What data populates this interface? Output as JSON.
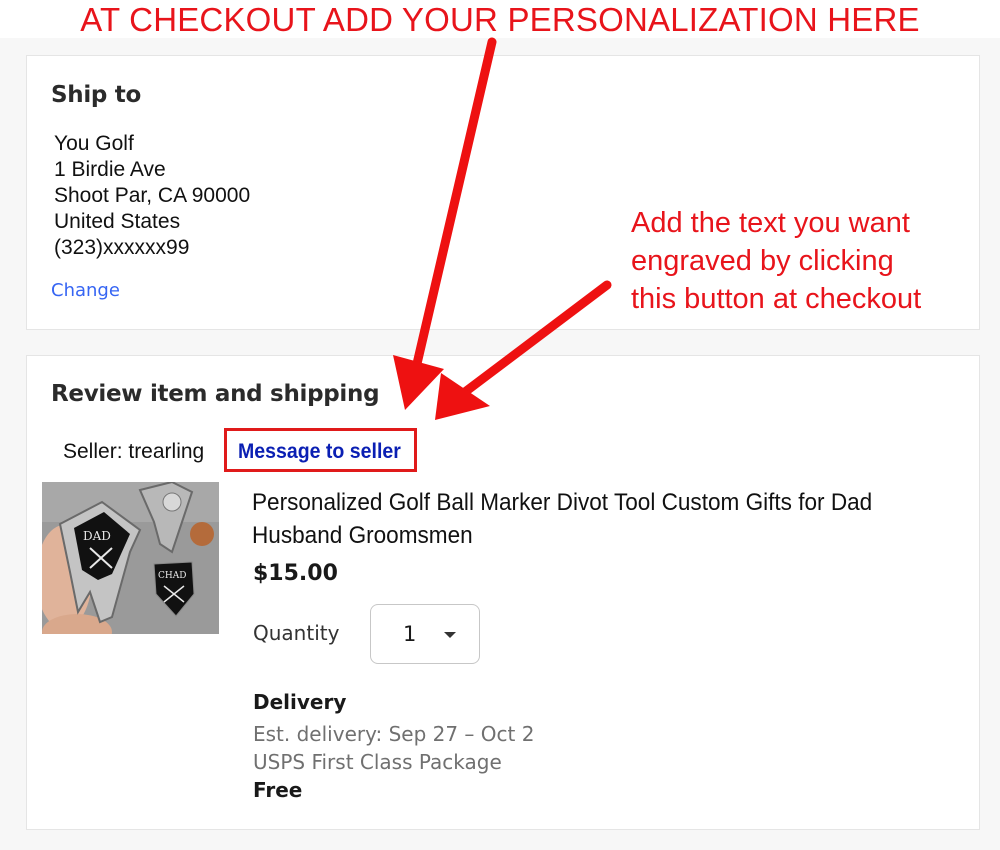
{
  "headline": "AT CHECKOUT ADD YOUR PERSONALIZATION HERE",
  "annotation": {
    "lines": [
      "Add the text you want",
      "engraved by clicking",
      "this button at checkout"
    ]
  },
  "ship_to": {
    "title": "Ship to",
    "address_lines": [
      "You Golf",
      "1 Birdie Ave",
      "Shoot Par, CA 90000",
      "United States",
      "(323)xxxxxx99"
    ],
    "change_label": "Change"
  },
  "review": {
    "title": "Review item and shipping",
    "seller_label": "Seller: trearling",
    "message_to_seller": "Message to seller",
    "product_image_text": [
      "DAD",
      "CHAD"
    ],
    "product_title": "Personalized Golf Ball Marker Divot Tool Custom Gifts for Dad Husband Groomsmen",
    "price": "$15.00",
    "quantity_label": "Quantity",
    "quantity_value": "1",
    "delivery": {
      "title": "Delivery",
      "estimate": "Est. delivery: Sep 27 – Oct 2",
      "service": "USPS First Class Package",
      "cost": "Free"
    }
  },
  "colors": {
    "annotation_red": "#e8141b",
    "link_blue": "#3665f3",
    "message_link_blue": "#0a1fb3"
  }
}
